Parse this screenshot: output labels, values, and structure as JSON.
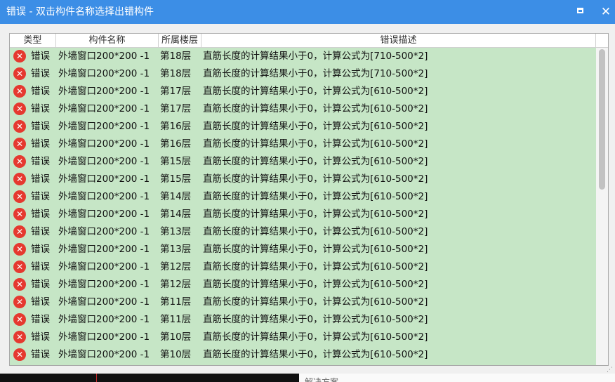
{
  "window": {
    "title": "错误 - 双击构件名称选择出错构件",
    "maximize_icon": "maximize-icon",
    "close_glyph": "✕"
  },
  "table": {
    "columns": [
      "类型",
      "构件名称",
      "所属楼层",
      "错误描述"
    ],
    "rows": [
      {
        "type": "错误",
        "name": "外墙窗口200*200 -1",
        "floor": "第18层",
        "desc": "直筋长度的计算结果小于0，计算公式为[710-500*2]"
      },
      {
        "type": "错误",
        "name": "外墙窗口200*200 -1",
        "floor": "第18层",
        "desc": "直筋长度的计算结果小于0，计算公式为[710-500*2]"
      },
      {
        "type": "错误",
        "name": "外墙窗口200*200 -1",
        "floor": "第17层",
        "desc": "直筋长度的计算结果小于0，计算公式为[610-500*2]"
      },
      {
        "type": "错误",
        "name": "外墙窗口200*200 -1",
        "floor": "第17层",
        "desc": "直筋长度的计算结果小于0，计算公式为[610-500*2]"
      },
      {
        "type": "错误",
        "name": "外墙窗口200*200 -1",
        "floor": "第16层",
        "desc": "直筋长度的计算结果小于0，计算公式为[610-500*2]"
      },
      {
        "type": "错误",
        "name": "外墙窗口200*200 -1",
        "floor": "第16层",
        "desc": "直筋长度的计算结果小于0，计算公式为[610-500*2]"
      },
      {
        "type": "错误",
        "name": "外墙窗口200*200 -1",
        "floor": "第15层",
        "desc": "直筋长度的计算结果小于0，计算公式为[610-500*2]"
      },
      {
        "type": "错误",
        "name": "外墙窗口200*200 -1",
        "floor": "第15层",
        "desc": "直筋长度的计算结果小于0，计算公式为[610-500*2]"
      },
      {
        "type": "错误",
        "name": "外墙窗口200*200 -1",
        "floor": "第14层",
        "desc": "直筋长度的计算结果小于0，计算公式为[610-500*2]"
      },
      {
        "type": "错误",
        "name": "外墙窗口200*200 -1",
        "floor": "第14层",
        "desc": "直筋长度的计算结果小于0，计算公式为[610-500*2]"
      },
      {
        "type": "错误",
        "name": "外墙窗口200*200 -1",
        "floor": "第13层",
        "desc": "直筋长度的计算结果小于0，计算公式为[610-500*2]"
      },
      {
        "type": "错误",
        "name": "外墙窗口200*200 -1",
        "floor": "第13层",
        "desc": "直筋长度的计算结果小于0，计算公式为[610-500*2]"
      },
      {
        "type": "错误",
        "name": "外墙窗口200*200 -1",
        "floor": "第12层",
        "desc": "直筋长度的计算结果小于0，计算公式为[610-500*2]"
      },
      {
        "type": "错误",
        "name": "外墙窗口200*200 -1",
        "floor": "第12层",
        "desc": "直筋长度的计算结果小于0，计算公式为[610-500*2]"
      },
      {
        "type": "错误",
        "name": "外墙窗口200*200 -1",
        "floor": "第11层",
        "desc": "直筋长度的计算结果小于0，计算公式为[610-500*2]"
      },
      {
        "type": "错误",
        "name": "外墙窗口200*200 -1",
        "floor": "第11层",
        "desc": "直筋长度的计算结果小于0，计算公式为[610-500*2]"
      },
      {
        "type": "错误",
        "name": "外墙窗口200*200 -1",
        "floor": "第10层",
        "desc": "直筋长度的计算结果小于0，计算公式为[610-500*2]"
      },
      {
        "type": "错误",
        "name": "外墙窗口200*200 -1",
        "floor": "第10层",
        "desc": "直筋长度的计算结果小于0，计算公式为[610-500*2]"
      }
    ]
  },
  "icons": {
    "row_icon": "error-icon",
    "row_icon_glyph": "✕"
  },
  "colors": {
    "titlebar": "#3c8ee6",
    "row_background": "#c6e6c6",
    "error_icon": "#e5392f"
  },
  "bottom": {
    "text": "解决方案"
  }
}
